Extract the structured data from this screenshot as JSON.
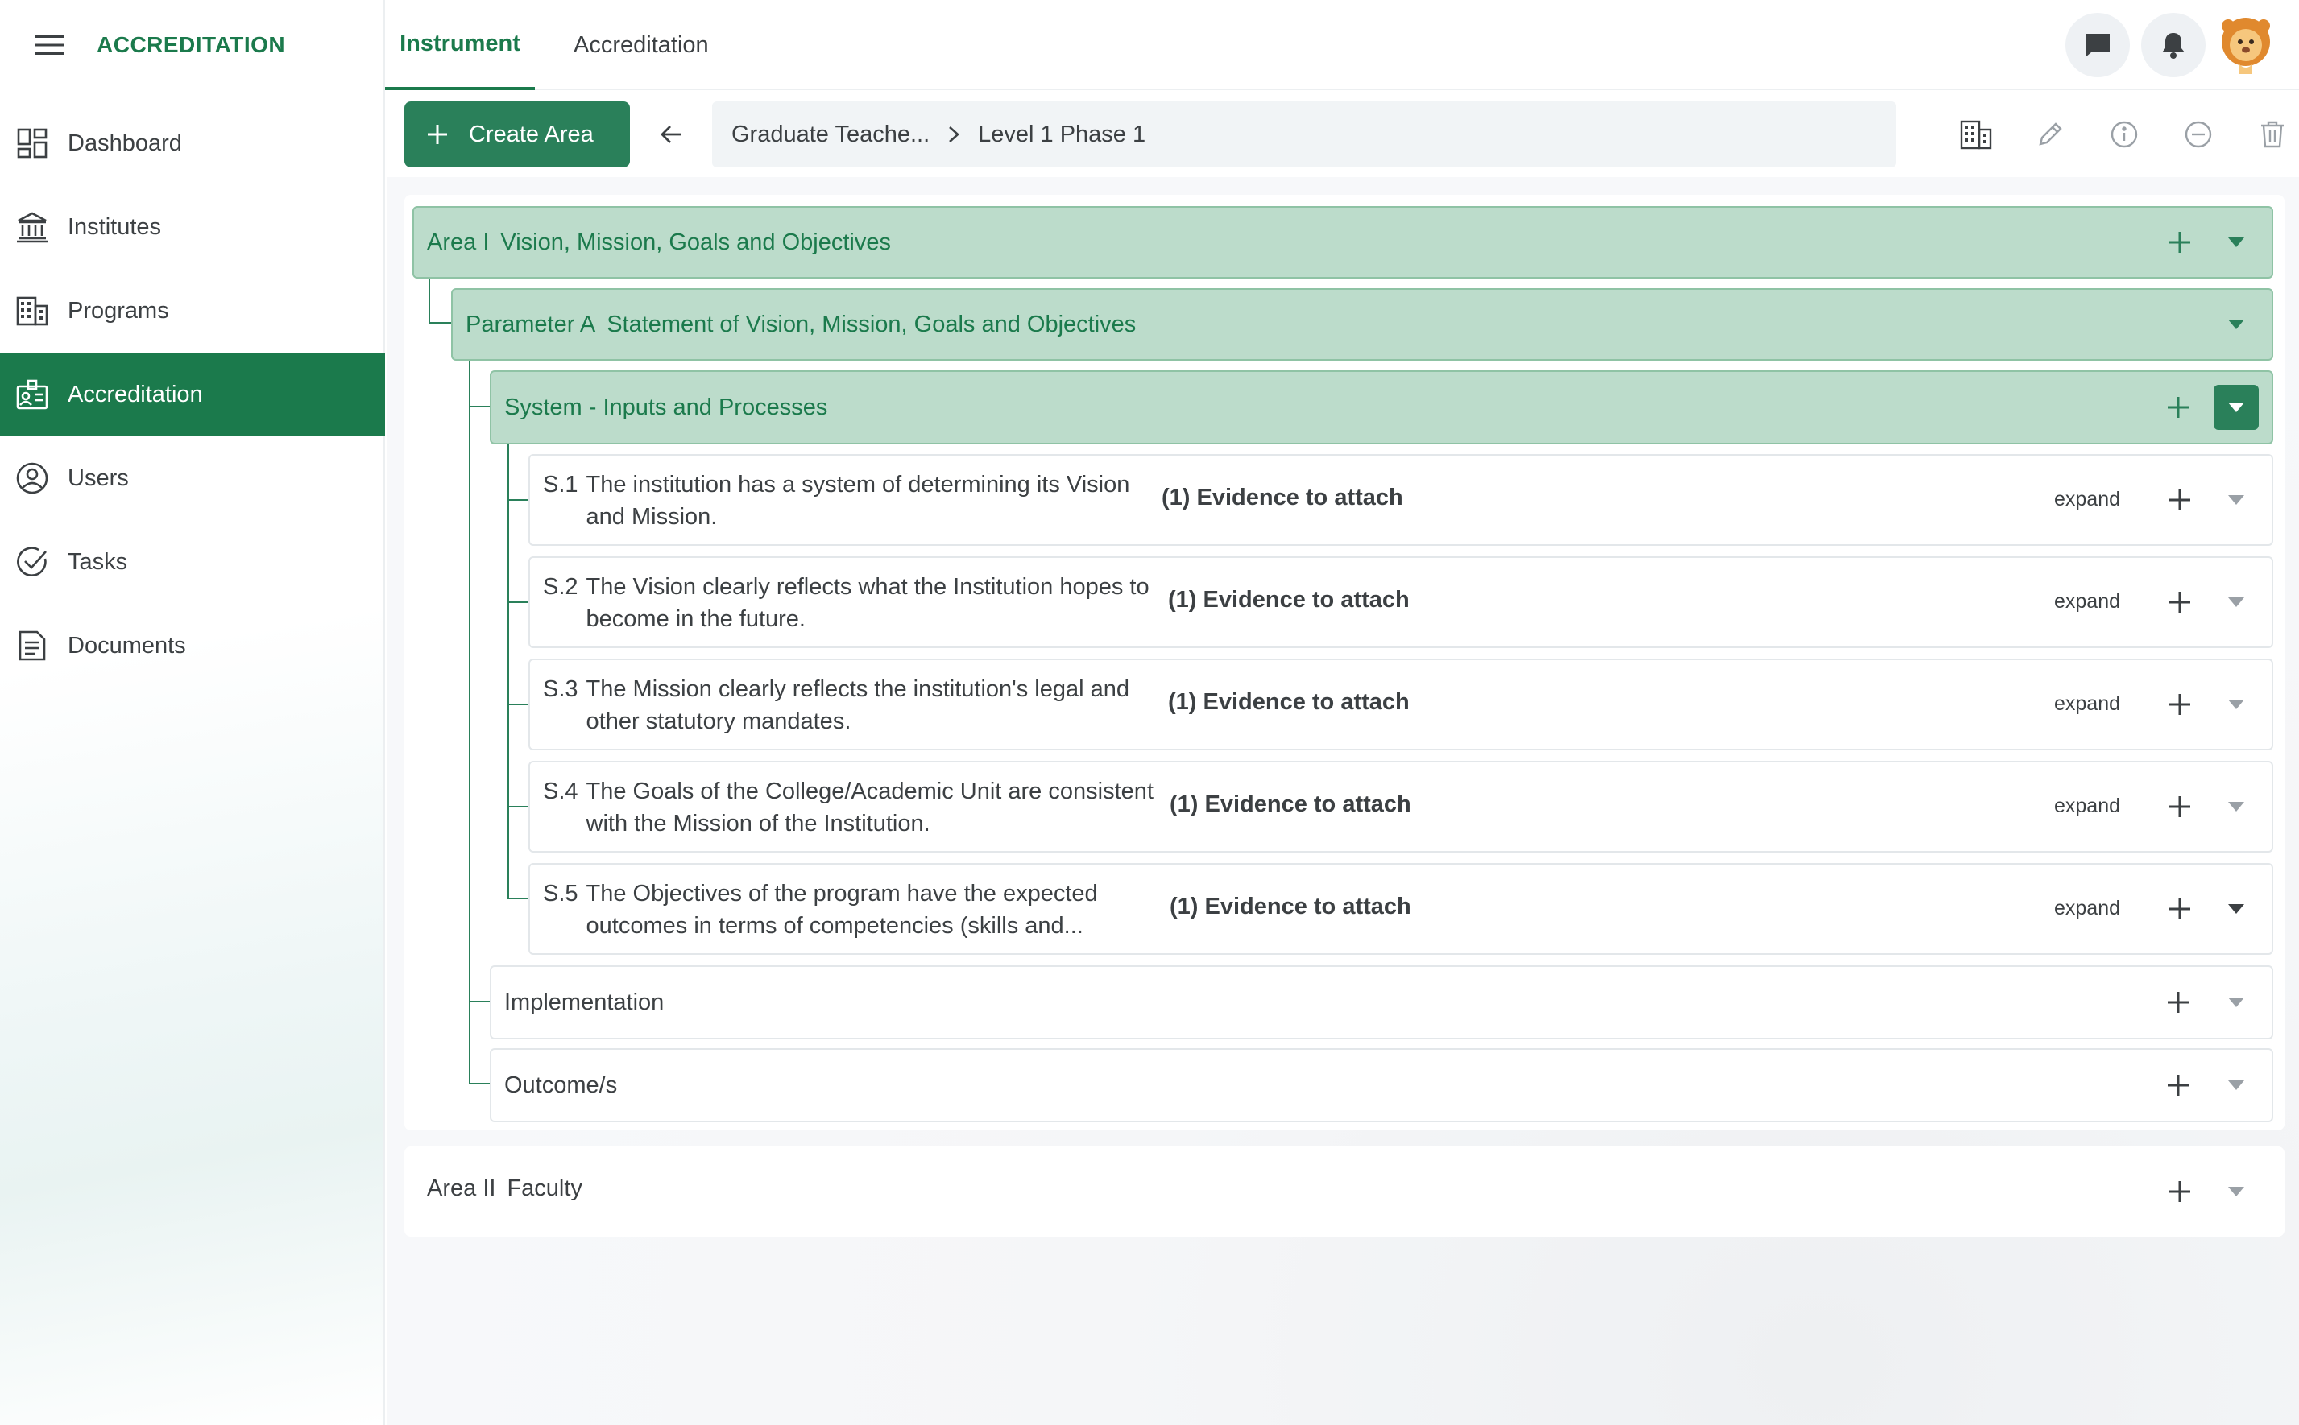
{
  "app": {
    "title": "ACCREDITATION"
  },
  "sidebar": {
    "items": [
      {
        "label": "Dashboard",
        "icon": "dashboard-icon"
      },
      {
        "label": "Institutes",
        "icon": "institution-icon"
      },
      {
        "label": "Programs",
        "icon": "building-icon"
      },
      {
        "label": "Accreditation",
        "icon": "accreditation-badge-icon",
        "active": true
      },
      {
        "label": "Users",
        "icon": "user-circle-icon"
      },
      {
        "label": "Tasks",
        "icon": "check-circle-icon"
      },
      {
        "label": "Documents",
        "icon": "document-icon"
      }
    ]
  },
  "header": {
    "tabs": [
      {
        "label": "Instrument",
        "active": true
      },
      {
        "label": "Accreditation",
        "active": false
      }
    ]
  },
  "toolbar": {
    "create_label": "Create Area",
    "breadcrumb": [
      "Graduate Teache...",
      "Level 1 Phase 1"
    ]
  },
  "tree": {
    "area1": {
      "code": "Area I",
      "title": "Vision, Mission, Goals and Objectives"
    },
    "paramA": {
      "code": "Parameter A",
      "title": "Statement of Vision, Mission, Goals and Objectives"
    },
    "system": {
      "title": "System - Inputs and Processes"
    },
    "items": [
      {
        "code": "S.1",
        "text": "The institution has a system of determining its Vision and Mission.",
        "evidence": "(1) Evidence to attach",
        "expand": "expand"
      },
      {
        "code": "S.2",
        "text": "The Vision clearly reflects what the Institution hopes to become in the future.",
        "evidence": "(1) Evidence to attach",
        "expand": "expand"
      },
      {
        "code": "S.3",
        "text": "The Mission clearly reflects the institution's legal and other statutory mandates.",
        "evidence": "(1) Evidence to attach",
        "expand": "expand"
      },
      {
        "code": "S.4",
        "text": "The Goals of the College/Academic Unit are consistent with the Mission of the Institution.",
        "evidence": "(1) Evidence to attach",
        "expand": "expand"
      },
      {
        "code": "S.5",
        "text": "The Objectives of the program have the expected outcomes in terms of competencies (skills and...",
        "evidence": "(1) Evidence to attach",
        "expand": "expand"
      }
    ],
    "implementation": {
      "title": "Implementation"
    },
    "outcomes": {
      "title": "Outcome/s"
    },
    "area2": {
      "code": "Area II",
      "title": "Faculty"
    }
  },
  "colors": {
    "accent": "#1b7a4c",
    "accent_button": "#2a805a",
    "green_row": "#bcdccb"
  }
}
